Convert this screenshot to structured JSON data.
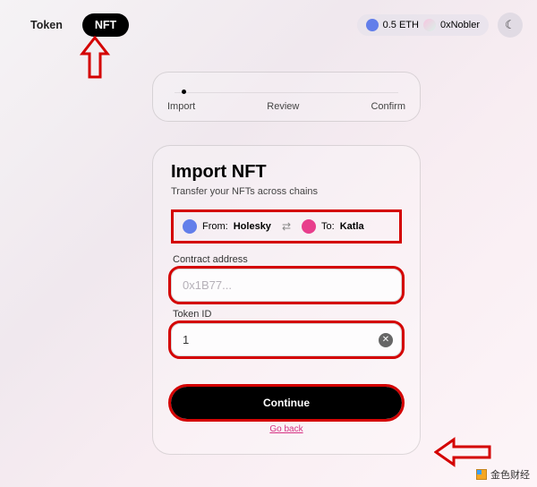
{
  "tabs": {
    "token": "Token",
    "nft": "NFT",
    "active": "nft"
  },
  "balance": {
    "amount": "0.5 ETH",
    "account": "0xNobler"
  },
  "theme_icon": "☾",
  "stepper": {
    "steps": [
      "Import",
      "Review",
      "Confirm"
    ],
    "current_index": 0
  },
  "card": {
    "title": "Import NFT",
    "subtitle": "Transfer your NFTs across chains",
    "from_label": "From:",
    "from_chain": "Holesky",
    "to_label": "To:",
    "to_chain": "Katla",
    "contract_label": "Contract address",
    "contract_placeholder": "0x1B77...",
    "contract_value": "",
    "tokenid_label": "Token ID",
    "tokenid_value": "1",
    "continue": "Continue",
    "go_back": "Go back"
  },
  "watermark": "金色财经"
}
